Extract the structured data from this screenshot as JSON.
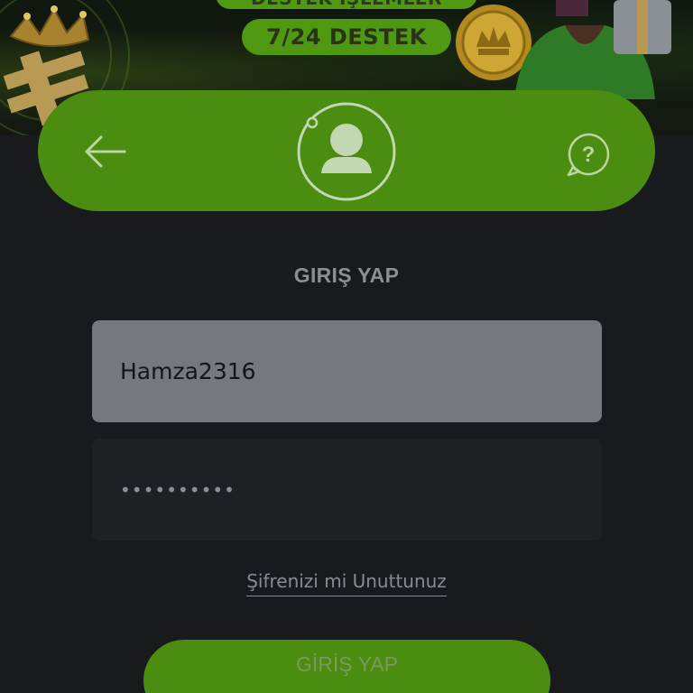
{
  "banner": {
    "top_text": "DESTEK İŞLEMLER",
    "support_text": "7/24 DESTEK"
  },
  "header": {
    "back_icon": "arrow-left-icon",
    "avatar_icon": "user-avatar-icon",
    "help_icon": "question-bubble-icon"
  },
  "form": {
    "title": "GIRIŞ YAP",
    "username_value": "Hamza2316",
    "password_value": "••••••••••",
    "forgot_link": "Şifrenizi mi Unuttunuz",
    "submit_label": "GİRİŞ YAP"
  },
  "colors": {
    "accent_green": "#4a8d11",
    "background": "#191a1d",
    "input_active": "#76787e",
    "input_inactive": "#1f2023"
  }
}
